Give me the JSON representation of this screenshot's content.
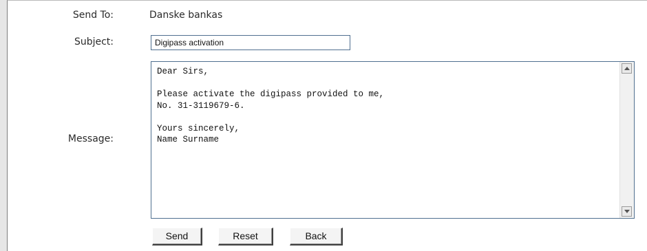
{
  "form": {
    "send_to_label": "Send To:",
    "send_to_value": "Danske bankas",
    "subject_label": "Subject:",
    "subject_value": "Digipass activation",
    "message_label": "Message:",
    "message_value": "Dear Sirs,\n\nPlease activate the digipass provided to me,\nNo. 31-3119679-6.\n\nYours sincerely,\nName Surname"
  },
  "buttons": {
    "send": "Send",
    "reset": "Reset",
    "back": "Back"
  },
  "icons": {
    "scroll_up": "scroll-up-arrow-icon",
    "scroll_down": "scroll-down-arrow-icon"
  }
}
